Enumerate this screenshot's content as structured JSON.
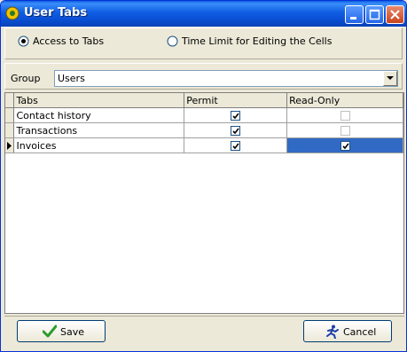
{
  "window": {
    "title": "User Tabs"
  },
  "options": {
    "access_label": "Access to Tabs",
    "time_limit_label": "Time Limit for Editing the Cells",
    "selected": "access"
  },
  "group": {
    "label": "Group",
    "value": "Users"
  },
  "grid": {
    "columns": [
      "Tabs",
      "Permit",
      "Read-Only"
    ],
    "rows": [
      {
        "tab": "Contact history",
        "permit": true,
        "read_only": false
      },
      {
        "tab": "Transactions",
        "permit": true,
        "read_only": false
      },
      {
        "tab": "Invoices",
        "permit": true,
        "read_only": true,
        "current": true
      }
    ]
  },
  "buttons": {
    "save": "Save",
    "cancel": "Cancel"
  },
  "colors": {
    "titlebar": "#0a50d6",
    "selection": "#316ac5",
    "face": "#ece9d8"
  }
}
